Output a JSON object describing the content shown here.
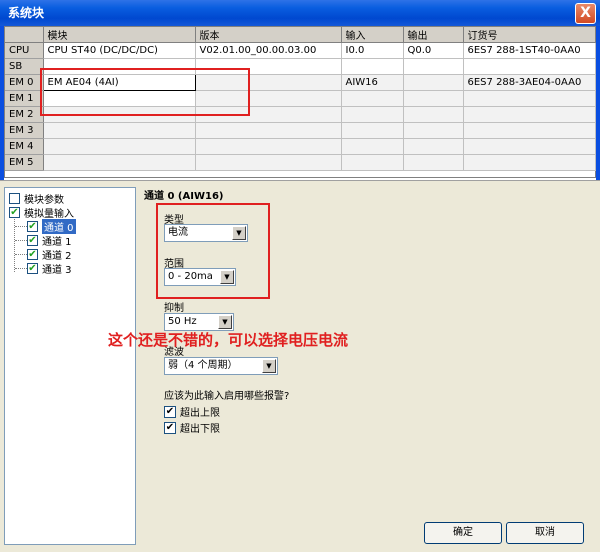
{
  "window": {
    "title": "系统块",
    "close_label": "X"
  },
  "grid": {
    "headers": [
      "",
      "模块",
      "版本",
      "输入",
      "输出",
      "订货号"
    ],
    "rows": [
      {
        "slot": "CPU",
        "module": "CPU ST40 (DC/DC/DC)",
        "version": "V02.01.00_00.00.03.00",
        "input": "I0.0",
        "output": "Q0.0",
        "order": "6ES7 288-1ST40-0AA0"
      },
      {
        "slot": "SB",
        "module": "",
        "version": "",
        "input": "",
        "output": "",
        "order": ""
      },
      {
        "slot": "EM 0",
        "module": "EM AE04 (4AI)",
        "version": "",
        "input": "AIW16",
        "output": "",
        "order": "6ES7 288-3AE04-0AA0"
      },
      {
        "slot": "EM 1",
        "module": "",
        "version": "",
        "input": "",
        "output": "",
        "order": ""
      },
      {
        "slot": "EM 2",
        "module": "",
        "version": "",
        "input": "",
        "output": "",
        "order": ""
      },
      {
        "slot": "EM 3",
        "module": "",
        "version": "",
        "input": "",
        "output": "",
        "order": ""
      },
      {
        "slot": "EM 4",
        "module": "",
        "version": "",
        "input": "",
        "output": "",
        "order": ""
      },
      {
        "slot": "EM 5",
        "module": "",
        "version": "",
        "input": "",
        "output": "",
        "order": ""
      }
    ]
  },
  "tree": {
    "module_params": "模块参数",
    "analog_input": "模拟量输入",
    "channels": [
      "通道 0",
      "通道 1",
      "通道 2",
      "通道 3"
    ]
  },
  "panel": {
    "title": "通道 0 (AIW16)",
    "type_label": "类型",
    "type_value": "电流",
    "range_label": "范围",
    "range_value": "0 - 20ma",
    "suppress_label": "抑制",
    "suppress_value": "50 Hz",
    "filter_label": "滤波",
    "filter_value": "弱（4 个周期）",
    "alarm_question": "应该为此输入启用哪些报警?",
    "alarm_upper": "超出上限",
    "alarm_lower": "超出下限",
    "ok_label": "确定",
    "cancel_label": "取消"
  },
  "annotation": {
    "text": "这个还是不错的，可以选择电压电流"
  },
  "colors": {
    "titlebar": "#0a5ee0",
    "annotation": "#e02020",
    "check": "#21a121"
  }
}
